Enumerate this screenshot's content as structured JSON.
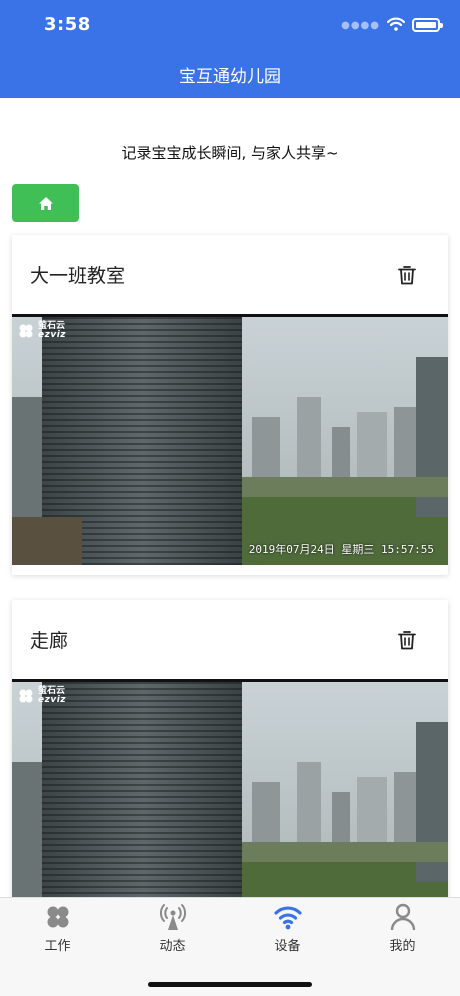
{
  "status_bar": {
    "time": "3:58"
  },
  "header": {
    "title": "宝互通幼儿园"
  },
  "slogan": "记录宝宝成长瞬间, 与家人共享~",
  "home_button": {
    "icon": "home-icon"
  },
  "devices": [
    {
      "name": "大一班教室",
      "overlay": {
        "brand_cn": "萤石云",
        "brand_en": "ezviz",
        "timestamp": "2019年07月24日 星期三 15:57:55"
      }
    },
    {
      "name": "走廊",
      "overlay": {
        "brand_cn": "萤石云",
        "brand_en": "ezviz"
      }
    }
  ],
  "tabbar": {
    "items": [
      {
        "label": "工作",
        "icon": "grid-icon",
        "active": false
      },
      {
        "label": "动态",
        "icon": "antenna-icon",
        "active": false
      },
      {
        "label": "设备",
        "icon": "wifi-icon",
        "active": true
      },
      {
        "label": "我的",
        "icon": "user-icon",
        "active": false
      }
    ]
  },
  "colors": {
    "primary": "#3a73e8",
    "success": "#3fbf55",
    "tab_inactive": "#8a8a8a"
  }
}
